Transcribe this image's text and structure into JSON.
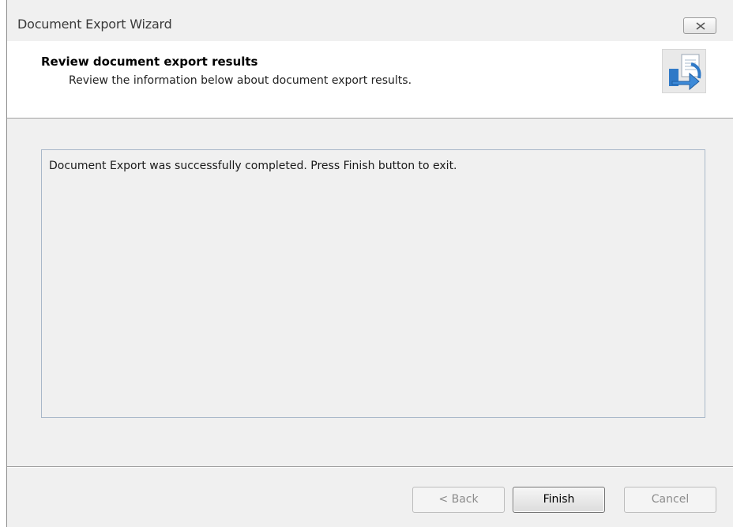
{
  "window": {
    "title": "Document Export Wizard"
  },
  "header": {
    "heading": "Review document export results",
    "subheading": "Review the information below about document export results.",
    "icon": "document-export-icon"
  },
  "results": {
    "message": "Document Export was successfully completed. Press Finish button to exit."
  },
  "buttons": {
    "back_label": "< Back",
    "finish_label": "Finish",
    "cancel_label": "Cancel",
    "back_enabled": false,
    "finish_enabled": true,
    "cancel_enabled": false
  },
  "colors": {
    "accent_blue": "#2f79c7",
    "background": "#f0f0f0"
  }
}
